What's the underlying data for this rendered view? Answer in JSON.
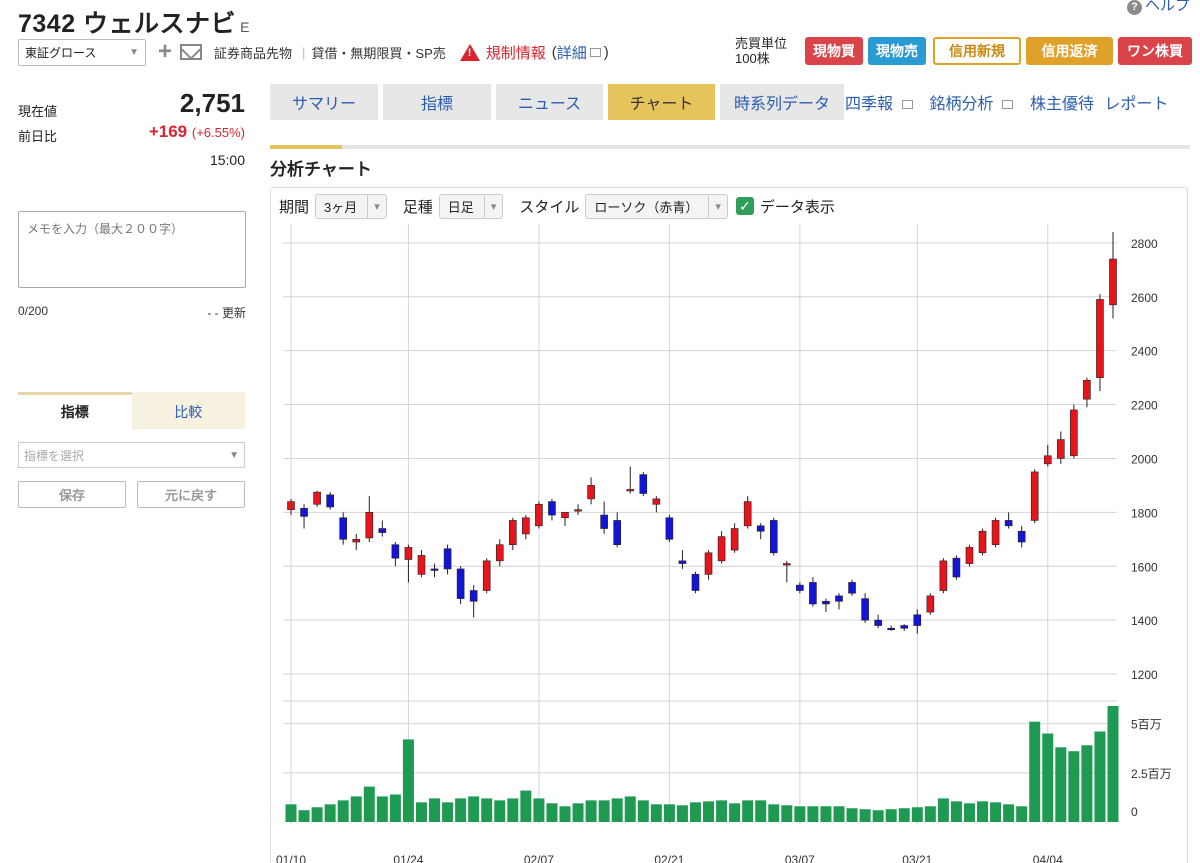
{
  "header": {
    "code_name": "7342 ウェルスナビ",
    "market_code": "E",
    "help": "ヘルプ",
    "market": "東証グロース",
    "products": "証券商品先物",
    "margin_info": "貸借・無期限買・SP売",
    "regulation": "規制情報",
    "detail": "詳細",
    "unit_label": "売買単位",
    "unit_value": "100株"
  },
  "trade_buttons": {
    "buy": "現物買",
    "sell": "現物売",
    "margin_new": "信用新規",
    "margin_repay": "信用返済",
    "one": "ワン株買"
  },
  "quote": {
    "price_label": "現在値",
    "price": "2,751",
    "change_label": "前日比",
    "change": "+169",
    "change_pct": "(+6.55%)",
    "time": "15:00"
  },
  "memo": {
    "placeholder": "メモを入力（最大２００字）",
    "count": "0/200",
    "updated": "- - 更新"
  },
  "indicator_panel": {
    "tab_indicator": "指標",
    "tab_compare": "比較",
    "select_placeholder": "指標を選択",
    "save": "保存",
    "reset": "元に戻す"
  },
  "tabs": [
    "サマリー",
    "指標",
    "ニュース",
    "チャート",
    "時系列データ"
  ],
  "active_tab": "チャート",
  "ext_links": [
    "四季報",
    "銘柄分析",
    "株主優待",
    "レポート"
  ],
  "section_title": "分析チャート",
  "controls": {
    "period_label": "期間",
    "period": "3ヶ月",
    "bar_label": "足種",
    "bar": "日足",
    "style_label": "スタイル",
    "style": "ローソク（赤青）",
    "data_display": "データ表示"
  },
  "colors": {
    "up": "#e8141c",
    "down": "#1414d8",
    "volume": "#1f9a52",
    "tab_active": "#e6c45c"
  },
  "chart_data": {
    "type": "candlestick",
    "x_labels": [
      "01/10",
      "01/24",
      "02/07",
      "02/21",
      "03/07",
      "03/21",
      "04/04"
    ],
    "y_ticks": [
      1200,
      1400,
      1600,
      1800,
      2000,
      2200,
      2400,
      2600,
      2800
    ],
    "ylim": [
      1100,
      2870
    ],
    "volume_ticks": [
      "0",
      "2.5百万",
      "5百万"
    ],
    "volume_ylim": [
      0,
      6000000
    ],
    "candles": [
      {
        "o": 1810,
        "h": 1850,
        "l": 1790,
        "c": 1840
      },
      {
        "o": 1815,
        "h": 1830,
        "l": 1740,
        "c": 1785
      },
      {
        "o": 1830,
        "h": 1880,
        "l": 1820,
        "c": 1875
      },
      {
        "o": 1865,
        "h": 1875,
        "l": 1810,
        "c": 1820
      },
      {
        "o": 1780,
        "h": 1800,
        "l": 1680,
        "c": 1700
      },
      {
        "o": 1690,
        "h": 1720,
        "l": 1660,
        "c": 1700
      },
      {
        "o": 1705,
        "h": 1860,
        "l": 1690,
        "c": 1800
      },
      {
        "o": 1740,
        "h": 1770,
        "l": 1710,
        "c": 1725
      },
      {
        "o": 1680,
        "h": 1690,
        "l": 1600,
        "c": 1630
      },
      {
        "o": 1625,
        "h": 1680,
        "l": 1540,
        "c": 1670
      },
      {
        "o": 1570,
        "h": 1660,
        "l": 1560,
        "c": 1640
      },
      {
        "o": 1590,
        "h": 1610,
        "l": 1560,
        "c": 1585
      },
      {
        "o": 1665,
        "h": 1680,
        "l": 1570,
        "c": 1590
      },
      {
        "o": 1590,
        "h": 1600,
        "l": 1460,
        "c": 1480
      },
      {
        "o": 1510,
        "h": 1530,
        "l": 1410,
        "c": 1470
      },
      {
        "o": 1510,
        "h": 1630,
        "l": 1500,
        "c": 1620
      },
      {
        "o": 1620,
        "h": 1700,
        "l": 1600,
        "c": 1680
      },
      {
        "o": 1680,
        "h": 1780,
        "l": 1660,
        "c": 1770
      },
      {
        "o": 1720,
        "h": 1790,
        "l": 1700,
        "c": 1780
      },
      {
        "o": 1750,
        "h": 1840,
        "l": 1740,
        "c": 1830
      },
      {
        "o": 1840,
        "h": 1850,
        "l": 1770,
        "c": 1790
      },
      {
        "o": 1780,
        "h": 1800,
        "l": 1750,
        "c": 1800
      },
      {
        "o": 1805,
        "h": 1830,
        "l": 1790,
        "c": 1810
      },
      {
        "o": 1850,
        "h": 1930,
        "l": 1830,
        "c": 1900
      },
      {
        "o": 1790,
        "h": 1840,
        "l": 1720,
        "c": 1740
      },
      {
        "o": 1770,
        "h": 1800,
        "l": 1670,
        "c": 1680
      },
      {
        "o": 1880,
        "h": 1970,
        "l": 1870,
        "c": 1885
      },
      {
        "o": 1940,
        "h": 1950,
        "l": 1860,
        "c": 1870
      },
      {
        "o": 1830,
        "h": 1860,
        "l": 1800,
        "c": 1850
      },
      {
        "o": 1780,
        "h": 1790,
        "l": 1690,
        "c": 1700
      },
      {
        "o": 1620,
        "h": 1660,
        "l": 1590,
        "c": 1610
      },
      {
        "o": 1570,
        "h": 1580,
        "l": 1500,
        "c": 1510
      },
      {
        "o": 1570,
        "h": 1660,
        "l": 1550,
        "c": 1650
      },
      {
        "o": 1620,
        "h": 1730,
        "l": 1610,
        "c": 1710
      },
      {
        "o": 1660,
        "h": 1760,
        "l": 1650,
        "c": 1740
      },
      {
        "o": 1750,
        "h": 1860,
        "l": 1740,
        "c": 1840
      },
      {
        "o": 1750,
        "h": 1760,
        "l": 1700,
        "c": 1730
      },
      {
        "o": 1770,
        "h": 1780,
        "l": 1640,
        "c": 1650
      },
      {
        "o": 1610,
        "h": 1620,
        "l": 1540,
        "c": 1610
      },
      {
        "o": 1530,
        "h": 1540,
        "l": 1500,
        "c": 1510
      },
      {
        "o": 1540,
        "h": 1560,
        "l": 1450,
        "c": 1460
      },
      {
        "o": 1470,
        "h": 1480,
        "l": 1430,
        "c": 1460
      },
      {
        "o": 1490,
        "h": 1500,
        "l": 1440,
        "c": 1470
      },
      {
        "o": 1540,
        "h": 1550,
        "l": 1490,
        "c": 1500
      },
      {
        "o": 1480,
        "h": 1500,
        "l": 1390,
        "c": 1400
      },
      {
        "o": 1400,
        "h": 1420,
        "l": 1370,
        "c": 1380
      },
      {
        "o": 1370,
        "h": 1380,
        "l": 1360,
        "c": 1365
      },
      {
        "o": 1380,
        "h": 1385,
        "l": 1360,
        "c": 1370
      },
      {
        "o": 1420,
        "h": 1440,
        "l": 1350,
        "c": 1380
      },
      {
        "o": 1430,
        "h": 1500,
        "l": 1420,
        "c": 1490
      },
      {
        "o": 1510,
        "h": 1630,
        "l": 1500,
        "c": 1620
      },
      {
        "o": 1630,
        "h": 1640,
        "l": 1550,
        "c": 1560
      },
      {
        "o": 1610,
        "h": 1680,
        "l": 1600,
        "c": 1670
      },
      {
        "o": 1650,
        "h": 1740,
        "l": 1640,
        "c": 1730
      },
      {
        "o": 1680,
        "h": 1780,
        "l": 1670,
        "c": 1770
      },
      {
        "o": 1770,
        "h": 1800,
        "l": 1740,
        "c": 1750
      },
      {
        "o": 1730,
        "h": 1750,
        "l": 1670,
        "c": 1690
      },
      {
        "o": 1770,
        "h": 1960,
        "l": 1760,
        "c": 1950
      },
      {
        "o": 1980,
        "h": 2050,
        "l": 1970,
        "c": 2010
      },
      {
        "o": 2000,
        "h": 2100,
        "l": 1980,
        "c": 2070
      },
      {
        "o": 2010,
        "h": 2200,
        "l": 2000,
        "c": 2180
      },
      {
        "o": 2220,
        "h": 2300,
        "l": 2190,
        "c": 2290
      },
      {
        "o": 2300,
        "h": 2610,
        "l": 2250,
        "c": 2590
      },
      {
        "o": 2570,
        "h": 2840,
        "l": 2520,
        "c": 2740
      }
    ],
    "volume": [
      900000,
      600000,
      750000,
      900000,
      1100000,
      1300000,
      1800000,
      1300000,
      1400000,
      4200000,
      1000000,
      1200000,
      1000000,
      1200000,
      1300000,
      1200000,
      1100000,
      1200000,
      1600000,
      1200000,
      950000,
      800000,
      950000,
      1100000,
      1100000,
      1200000,
      1300000,
      1100000,
      900000,
      900000,
      850000,
      1000000,
      1050000,
      1100000,
      950000,
      1100000,
      1100000,
      900000,
      850000,
      800000,
      800000,
      800000,
      800000,
      700000,
      650000,
      600000,
      650000,
      700000,
      750000,
      800000,
      1200000,
      1050000,
      950000,
      1050000,
      1000000,
      900000,
      800000,
      5100000,
      4500000,
      3800000,
      3600000,
      3900000,
      4600000,
      5900000
    ]
  }
}
